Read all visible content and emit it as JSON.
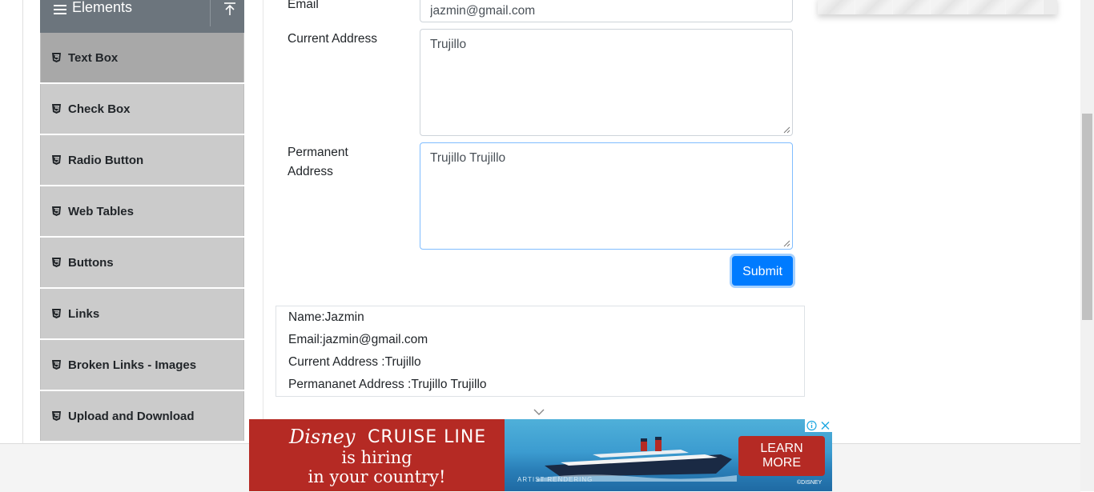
{
  "sidebar": {
    "group_title": "Elements",
    "items": [
      {
        "label": "Text Box",
        "active": true
      },
      {
        "label": "Check Box",
        "active": false
      },
      {
        "label": "Radio Button",
        "active": false
      },
      {
        "label": "Web Tables",
        "active": false
      },
      {
        "label": "Buttons",
        "active": false
      },
      {
        "label": "Links",
        "active": false
      },
      {
        "label": "Broken Links - Images",
        "active": false
      },
      {
        "label": "Upload and Download",
        "active": false
      }
    ]
  },
  "form": {
    "email": {
      "label": "Email",
      "value": "jazmin@gmail.com"
    },
    "current_address": {
      "label": "Current Address",
      "value": "Trujillo"
    },
    "permanent_address": {
      "label_line1": "Permanent",
      "label_line2": "Address",
      "value": "Trujillo Trujillo"
    },
    "submit_label": "Submit"
  },
  "output": {
    "name": "Name:Jazmin",
    "email": "Email:jazmin@gmail.com",
    "current_address": "Current Address :Trujillo",
    "permanent_address": "Permananet Address :Trujillo Trujillo"
  },
  "ad": {
    "brand": "Disney",
    "brand_line": "CRUISE LINE",
    "headline_line1": "is hiring",
    "headline_line2": "in your country!",
    "cta_line1": "LEARN",
    "cta_line2": "MORE",
    "footnote": "ARTIST RENDERING",
    "copyright": "©DISNEY",
    "colors": {
      "red": "#b52a24",
      "sea": "#3c9cd0"
    }
  },
  "colors": {
    "primary": "#007bff",
    "sidebar_header": "#6c757d",
    "menu_item": "#cbcbcb",
    "menu_item_active": "#a8a8a8"
  }
}
